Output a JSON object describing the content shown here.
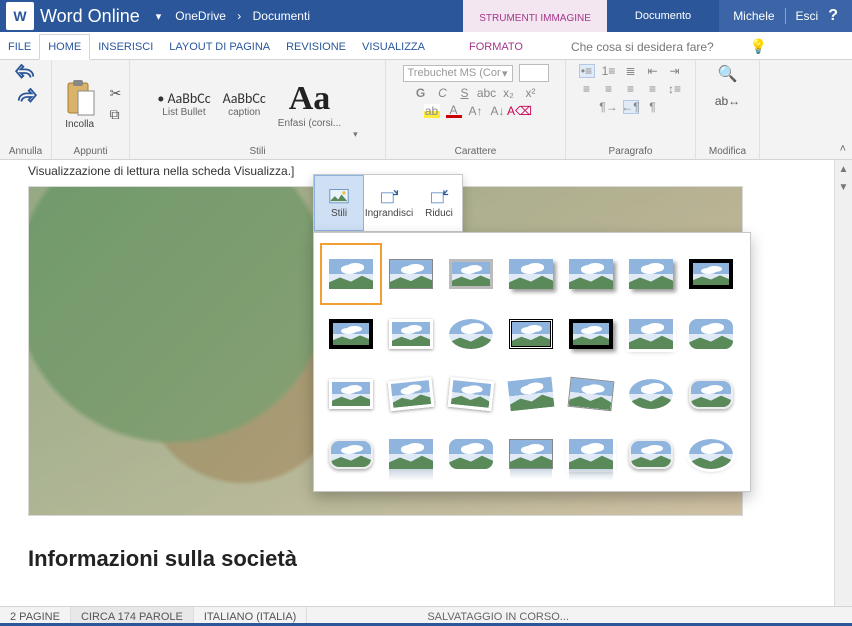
{
  "title": {
    "app": "Word Online",
    "breadcrumb_root": "OneDrive",
    "breadcrumb_sep": "›",
    "breadcrumb_leaf": "Documenti",
    "context_tools": "STRUMENTI IMMAGINE",
    "doc_name": "Documento",
    "user": "Michele",
    "signout": "Esci",
    "help": "?"
  },
  "tabs": {
    "file": "FILE",
    "home": "HOME",
    "insert": "INSERISCI",
    "layout": "LAYOUT DI PAGINA",
    "review": "REVISIONE",
    "view": "VISUALIZZA",
    "format": "FORMATO",
    "tellme": "Che cosa si desidera fare?"
  },
  "ribbon": {
    "undo_group": "Annulla",
    "clipboard_group": "Appunti",
    "paste": "Incolla",
    "styles_group": "Stili",
    "style1_preview": "• AaBbCc",
    "style1_name": "List Bullet",
    "style2_preview": "AaBbCc",
    "style2_name": "caption",
    "style3_preview": "Aa",
    "style3_name": "Enfasi (corsi...",
    "char_group": "Carattere",
    "font_name": "Trebuchet MS (Cor",
    "g": "G",
    "c": "C",
    "s": "S",
    "para_group": "Paragrafo",
    "edit_group": "Modifica"
  },
  "minitoolbar": {
    "styles": "Stili",
    "enlarge": "Ingrandisci",
    "shrink": "Riduci"
  },
  "doc": {
    "hint": "Visualizzazione di lettura nella scheda Visualizza.]",
    "heading": "Informazioni sulla società"
  },
  "status": {
    "pages": "2 PAGINE",
    "words": "CIRCA 174 PAROLE",
    "lang": "ITALIANO (ITALIA)",
    "saving": "SALVATAGGIO IN CORSO..."
  }
}
